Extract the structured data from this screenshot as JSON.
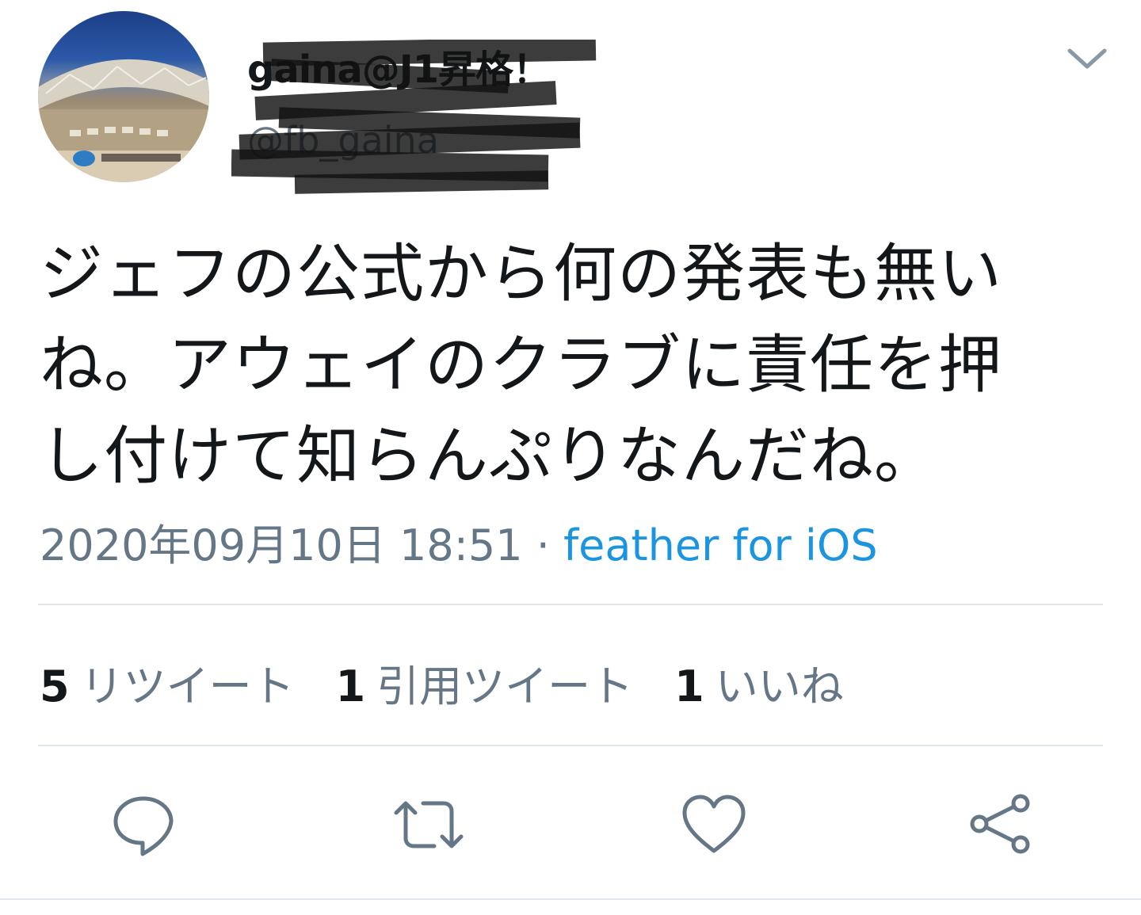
{
  "tweet": {
    "display_name": "gaina@J1昇格！",
    "handle": "@fb_gaina",
    "text_lines": [
      "ジェフの公式から何の発表も無い",
      "ね。アウェイのクラブに責任を押",
      "し付けて知らんぷりなんだね。"
    ],
    "timestamp": "2020年09月10日 18:51",
    "separator": " · ",
    "source": "feather for iOS"
  },
  "stats": {
    "retweets": {
      "count": "5",
      "label": "リツイート"
    },
    "quote_tweets": {
      "count": "1",
      "label": "引用ツイート"
    },
    "likes": {
      "count": "1",
      "label": "いいね"
    }
  },
  "actions": {
    "reply": "reply-icon",
    "retweet": "retweet-icon",
    "like": "heart-icon",
    "share": "share-icon"
  },
  "colors": {
    "text": "#14171a",
    "secondary": "#657786",
    "link": "#1b95e0",
    "divider": "#e1e8ed",
    "redaction": "#111111"
  }
}
